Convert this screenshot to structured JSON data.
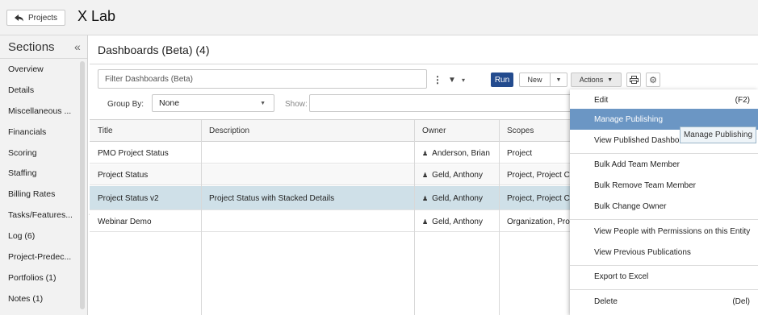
{
  "topbar": {
    "back_label": "Projects",
    "app_title": "X Lab"
  },
  "sidebar": {
    "title": "Sections",
    "collapse_glyph": "«",
    "items": [
      {
        "label": "Overview"
      },
      {
        "label": "Details"
      },
      {
        "label": "Miscellaneous ..."
      },
      {
        "label": "Financials"
      },
      {
        "label": "Scoring"
      },
      {
        "label": "Staffing"
      },
      {
        "label": "Billing Rates"
      },
      {
        "label": "Tasks/Features..."
      },
      {
        "label": "Log (6)"
      },
      {
        "label": "Project-Predec..."
      },
      {
        "label": "Portfolios (1)"
      },
      {
        "label": "Notes (1)"
      }
    ]
  },
  "panel": {
    "title": "Dashboards (Beta) (4)"
  },
  "toolbar": {
    "filter_placeholder": "Filter Dashboards (Beta)",
    "run_label": "Run",
    "new_label": "New",
    "actions_label": "Actions"
  },
  "groupby": {
    "label": "Group By:",
    "value": "None",
    "show_label": "Show:"
  },
  "grid": {
    "columns": [
      "Title",
      "Description",
      "Owner",
      "Scopes"
    ],
    "rows": [
      {
        "title": "PMO Project Status",
        "description": "",
        "owner": "Anderson, Brian",
        "scopes": "Project"
      },
      {
        "title": "Project Status",
        "description": "",
        "owner": "Geld, Anthony",
        "scopes": "Project, Project C"
      },
      {
        "title": "Project Status v2",
        "description": "Project Status with Stacked Details",
        "owner": "Geld, Anthony",
        "scopes": "Project, Project C",
        "selected": true
      },
      {
        "title": "Webinar Demo",
        "description": "",
        "owner": "Geld, Anthony",
        "scopes": "Organization, Pro"
      }
    ]
  },
  "actions_menu": {
    "items": [
      {
        "label": "Edit",
        "shortcut": "(F2)"
      },
      {
        "label": "Manage Publishing",
        "highlighted": true
      },
      {
        "label": "View Published Dashbo"
      },
      {
        "label": "Bulk Add Team Member"
      },
      {
        "label": "Bulk Remove Team Member"
      },
      {
        "label": "Bulk Change Owner"
      },
      {
        "label": "View People with Permissions on this Entity"
      },
      {
        "label": "View Previous Publications"
      },
      {
        "label": "Export to Excel"
      },
      {
        "label": "Delete",
        "shortcut": "(Del)"
      }
    ]
  },
  "tooltip": {
    "text": "Manage Publishing"
  },
  "colors": {
    "run_button": "#234b8e",
    "menu_highlight": "#6b96c4",
    "selected_row": "#cfe0e8"
  },
  "icons": [
    "back-arrow-icon",
    "kebab-icon",
    "filter-icon",
    "print-icon",
    "gear-icon",
    "person-icon"
  ]
}
